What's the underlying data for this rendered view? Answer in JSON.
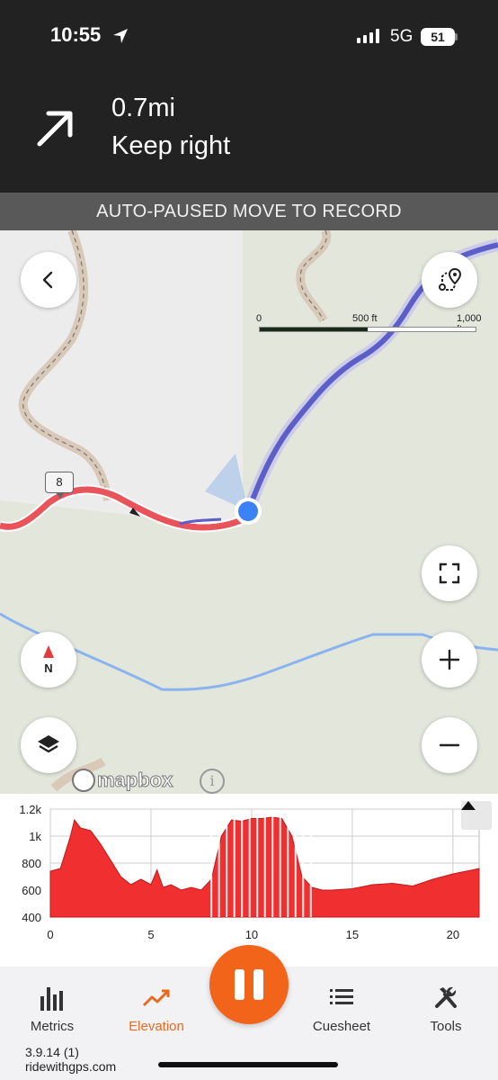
{
  "status_bar": {
    "time": "10:55",
    "network": "5G",
    "battery": "51"
  },
  "navigation": {
    "distance": "0.7mi",
    "instruction": "Keep right",
    "turn_icon": "arrow-up-right-icon"
  },
  "banner": {
    "text": "AUTO-PAUSED MOVE TO RECORD"
  },
  "map": {
    "scale": {
      "labels": [
        "0",
        "500 ft",
        "1,000 ft"
      ]
    },
    "waypoint_marker": "8",
    "attribution": "mapbox",
    "info_glyph": "i",
    "buttons": [
      "back-icon",
      "route-overview-icon",
      "fullscreen-icon",
      "compass-icon",
      "zoom-in-icon",
      "layers-icon",
      "zoom-out-icon"
    ],
    "compass_label": "N",
    "colors": {
      "route_done": "#e8545a",
      "route_ahead": "#5b5fc7",
      "location": "#3b82f6",
      "water": "#8ab4ef"
    }
  },
  "elevation": {
    "y_ticks": [
      "1.2k",
      "1k",
      "800",
      "600",
      "400"
    ],
    "x_ticks": [
      "0",
      "5",
      "10",
      "15",
      "20"
    ],
    "fill_color": "#f03030"
  },
  "chart_data": {
    "type": "area",
    "title": "",
    "xlabel": "",
    "ylabel": "",
    "xlim": [
      0,
      21.3
    ],
    "ylim": [
      400,
      1200
    ],
    "x": [
      0,
      0.5,
      1,
      1.2,
      1.5,
      2,
      2.5,
      3,
      3.5,
      4,
      4.5,
      5,
      5.3,
      5.6,
      6,
      6.5,
      7,
      7.5,
      8,
      8.5,
      9,
      9.5,
      10,
      10.5,
      11,
      11.5,
      12,
      12.5,
      13,
      13.5,
      14,
      15,
      16,
      17,
      18,
      19,
      20,
      21,
      21.3
    ],
    "y": [
      740,
      760,
      1000,
      1120,
      1060,
      1040,
      940,
      820,
      700,
      640,
      680,
      640,
      750,
      620,
      640,
      600,
      620,
      600,
      680,
      1000,
      1120,
      1110,
      1130,
      1130,
      1140,
      1130,
      1000,
      700,
      620,
      600,
      600,
      610,
      640,
      650,
      630,
      680,
      720,
      750,
      760
    ]
  },
  "tabs": [
    {
      "label": "Metrics",
      "icon": "bar-chart-icon"
    },
    {
      "label": "Elevation",
      "icon": "trend-up-icon"
    },
    {
      "label": "Cuesheet",
      "icon": "list-icon"
    },
    {
      "label": "Tools",
      "icon": "tools-icon"
    }
  ],
  "footer": {
    "version": "3.9.14 (1)",
    "site": "ridewithgps.com"
  }
}
